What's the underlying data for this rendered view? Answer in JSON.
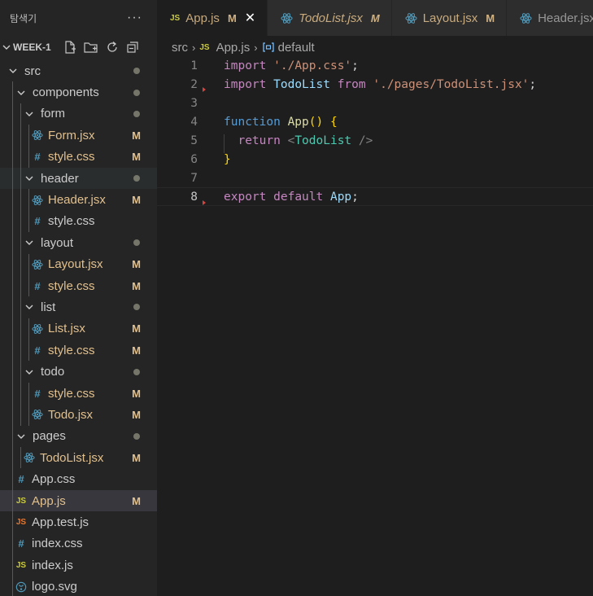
{
  "sidebar": {
    "title": "탐색기",
    "more": "···",
    "workspace": "WEEK-1"
  },
  "tree": [
    {
      "label": "src",
      "kind": "folder",
      "depth": 0,
      "open": true,
      "dot": true
    },
    {
      "label": "components",
      "kind": "folder",
      "depth": 1,
      "open": true,
      "dot": true
    },
    {
      "label": "form",
      "kind": "folder",
      "depth": 2,
      "open": true,
      "dot": true
    },
    {
      "label": "Form.jsx",
      "kind": "react",
      "depth": 3,
      "status": "M"
    },
    {
      "label": "style.css",
      "kind": "css",
      "depth": 3,
      "status": "M"
    },
    {
      "label": "header",
      "kind": "folder",
      "depth": 2,
      "open": true,
      "dot": true,
      "hover": true
    },
    {
      "label": "Header.jsx",
      "kind": "react",
      "depth": 3,
      "status": "M"
    },
    {
      "label": "style.css",
      "kind": "css",
      "depth": 3
    },
    {
      "label": "layout",
      "kind": "folder",
      "depth": 2,
      "open": true,
      "dot": true
    },
    {
      "label": "Layout.jsx",
      "kind": "react",
      "depth": 3,
      "status": "M"
    },
    {
      "label": "style.css",
      "kind": "css",
      "depth": 3,
      "status": "M"
    },
    {
      "label": "list",
      "kind": "folder",
      "depth": 2,
      "open": true,
      "dot": true
    },
    {
      "label": "List.jsx",
      "kind": "react",
      "depth": 3,
      "status": "M"
    },
    {
      "label": "style.css",
      "kind": "css",
      "depth": 3,
      "status": "M"
    },
    {
      "label": "todo",
      "kind": "folder",
      "depth": 2,
      "open": true,
      "dot": true
    },
    {
      "label": "style.css",
      "kind": "css",
      "depth": 3,
      "status": "M"
    },
    {
      "label": "Todo.jsx",
      "kind": "react",
      "depth": 3,
      "status": "M"
    },
    {
      "label": "pages",
      "kind": "folder",
      "depth": 1,
      "open": true,
      "dot": true
    },
    {
      "label": "TodoList.jsx",
      "kind": "react",
      "depth": 2,
      "status": "M"
    },
    {
      "label": "App.css",
      "kind": "css",
      "depth": 1
    },
    {
      "label": "App.js",
      "kind": "js",
      "depth": 1,
      "status": "M",
      "selected": true
    },
    {
      "label": "App.test.js",
      "kind": "jstest",
      "depth": 1
    },
    {
      "label": "index.css",
      "kind": "css",
      "depth": 1
    },
    {
      "label": "index.js",
      "kind": "js",
      "depth": 1
    },
    {
      "label": "logo.svg",
      "kind": "svg",
      "depth": 1
    }
  ],
  "tabs": [
    {
      "label": "App.js",
      "status": "M",
      "kind": "js",
      "active": true,
      "close": "✕"
    },
    {
      "label": "TodoList.jsx",
      "status": "M",
      "kind": "react",
      "italic": true
    },
    {
      "label": "Layout.jsx",
      "status": "M",
      "kind": "react"
    },
    {
      "label": "Header.jsx",
      "kind": "react"
    }
  ],
  "breadcrumb": {
    "folder": "src",
    "file_icon": "JS",
    "file": "App.js",
    "symbol": "default"
  },
  "icons": {
    "js": "JS",
    "css": "#"
  },
  "code": {
    "current_line": 8,
    "lines": [
      {
        "n": "1",
        "tokens": [
          [
            "ctl",
            "import"
          ],
          [
            "punc",
            " "
          ],
          [
            "str",
            "'./App.css'"
          ],
          [
            "punc",
            ";"
          ]
        ]
      },
      {
        "n": "2",
        "mark": true,
        "tokens": [
          [
            "ctl",
            "import"
          ],
          [
            "punc",
            " "
          ],
          [
            "var",
            "TodoList"
          ],
          [
            "punc",
            " "
          ],
          [
            "ctl",
            "from"
          ],
          [
            "punc",
            " "
          ],
          [
            "str",
            "'./pages/TodoList.jsx'"
          ],
          [
            "punc",
            ";"
          ]
        ]
      },
      {
        "n": "3",
        "tokens": []
      },
      {
        "n": "4",
        "tokens": [
          [
            "kw",
            "function"
          ],
          [
            "punc",
            " "
          ],
          [
            "fn",
            "App"
          ],
          [
            "br1",
            "()"
          ],
          [
            "punc",
            " "
          ],
          [
            "br1",
            "{"
          ]
        ]
      },
      {
        "n": "5",
        "indent": true,
        "tokens": [
          [
            "punc",
            "  "
          ],
          [
            "ctl",
            "return"
          ],
          [
            "punc",
            " "
          ],
          [
            "gray",
            "<"
          ],
          [
            "tag",
            "TodoList"
          ],
          [
            "punc",
            " "
          ],
          [
            "gray",
            "/>"
          ]
        ]
      },
      {
        "n": "6",
        "tokens": [
          [
            "br1",
            "}"
          ]
        ]
      },
      {
        "n": "7",
        "tokens": []
      },
      {
        "n": "8",
        "mark": true,
        "tokens": [
          [
            "ctl",
            "export"
          ],
          [
            "punc",
            " "
          ],
          [
            "ctl",
            "default"
          ],
          [
            "punc",
            " "
          ],
          [
            "var",
            "App"
          ],
          [
            "punc",
            ";"
          ]
        ]
      }
    ]
  },
  "colors": {
    "modified": "#e2c08d",
    "react": "#519aba",
    "js": "#cbcb41",
    "css": "#519aba"
  }
}
